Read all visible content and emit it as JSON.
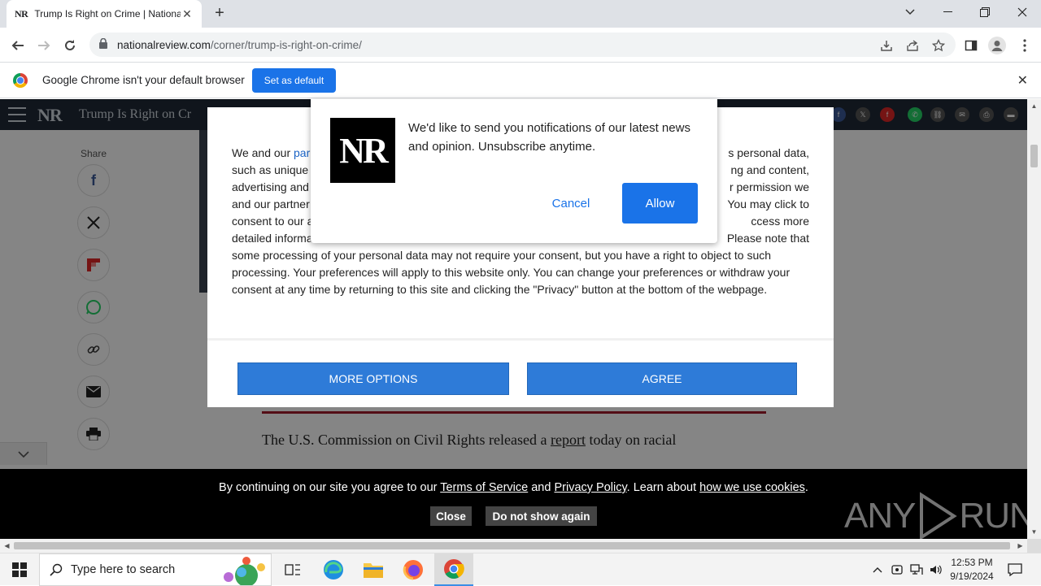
{
  "browser": {
    "tab_title": "Trump Is Right on Crime | National Review",
    "tab_favicon": "NR",
    "url_host": "nationalreview.com",
    "url_path": "/corner/trump-is-right-on-crime/"
  },
  "infobar": {
    "message": "Google Chrome isn't your default browser",
    "set_default_label": "Set as default"
  },
  "site_header": {
    "logo": "NR",
    "title": "Trump Is Right on Cr"
  },
  "share": {
    "label": "Share"
  },
  "article": {
    "text_before_link": "The U.S. Commission on Civil Rights released a ",
    "link_text": "report",
    "text_after_link": " today on racial"
  },
  "consent": {
    "text_part1": "We and our ",
    "link": "par",
    "text_part2": "s personal data, such as unique ... ng and content, advertising and ... r permission we and our partner ... You may click to consent to our ... ccess more detailed informa... Please note that some processing of your personal data may not require your consent, but you have a right to object to such processing. Your preferences will apply to this website only. You can change your preferences or withdraw your consent at any time by returning to this site and clicking the \"Privacy\" button at the bottom of the webpage.",
    "line1": "We and our",
    "line1_link": "par",
    "line1_tail": "s personal data,",
    "line2_head": "such as unique",
    "line2_tail": "ng and content,",
    "line3_head": "advertising and",
    "line3_tail": "r permission we",
    "line4_head": "and our partner",
    "line4_tail": "You may click to",
    "line5_head": "consent to our a",
    "line5_tail": "ccess more",
    "line6_head": "detailed informa",
    "line6_tail": "Please note that",
    "line7": "some processing of your personal data may not require your consent, but you have a right to object to such",
    "line8": "processing. Your preferences will apply to this website only. You can change your preferences or withdraw your",
    "line9": "consent at any time by returning to this site and clicking the \"Privacy\" button at the bottom of the webpage.",
    "more_options_label": "MORE OPTIONS",
    "agree_label": "AGREE"
  },
  "notification_prompt": {
    "logo": "NR",
    "message": "We'd like to send you notifications of our latest news and opinion. Unsubscribe anytime.",
    "cancel_label": "Cancel",
    "allow_label": "Allow"
  },
  "cookie_bar": {
    "text1": "By continuing on our site you agree to our ",
    "terms_link": "Terms of Service",
    "text2": " and ",
    "privacy_link": "Privacy Policy",
    "text3": ". Learn about ",
    "cookies_link": "how we use cookies",
    "text4": ".",
    "close_label": "Close",
    "dont_show_label": "Do not show again"
  },
  "watermark": {
    "left": "ANY",
    "right": "RUN"
  },
  "taskbar": {
    "search_placeholder": "Type here to search",
    "time": "12:53 PM",
    "date": "9/19/2024"
  },
  "colors": {
    "chrome_blue": "#1a73e8",
    "nr_header": "#1f2a36",
    "consent_button": "#2e7bd8",
    "article_rule": "#a11c2b"
  }
}
